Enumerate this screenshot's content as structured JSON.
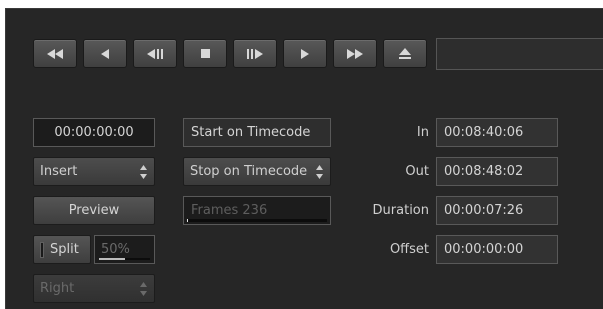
{
  "transport": {
    "buttons": [
      {
        "name": "rewind-button",
        "icon": "rewind-icon"
      },
      {
        "name": "play-reverse-button",
        "icon": "play-reverse-icon"
      },
      {
        "name": "step-back-button",
        "icon": "step-back-icon"
      },
      {
        "name": "stop-button",
        "icon": "stop-icon"
      },
      {
        "name": "step-forward-button",
        "icon": "step-forward-icon"
      },
      {
        "name": "play-button",
        "icon": "play-icon"
      },
      {
        "name": "fast-forward-button",
        "icon": "fast-forward-icon"
      },
      {
        "name": "eject-button",
        "icon": "eject-icon"
      }
    ],
    "timecode_display": ""
  },
  "left_column": {
    "timecode": "00:00:00:00",
    "mode_select": "Insert",
    "preview_label": "Preview",
    "split_label": "Split",
    "split_percent": "50%",
    "split_level": 0.5,
    "channel_select": "Right"
  },
  "middle_column": {
    "start_on_timecode": "Start on Timecode",
    "stop_on_timecode_select": "Stop on Timecode",
    "frames_text": "Frames 236",
    "frames_progress": 0.01
  },
  "right_column": {
    "in_label": "In",
    "in_value": "00:08:40:06",
    "out_label": "Out",
    "out_value": "00:08:48:02",
    "duration_label": "Duration",
    "duration_value": "00:00:07:26",
    "offset_label": "Offset",
    "offset_value": "00:00:00:00"
  },
  "colors": {
    "panel_bg": "#262626",
    "field_border": "#595959",
    "text": "#d4d4d4",
    "disabled_text": "#6a6a6a"
  }
}
